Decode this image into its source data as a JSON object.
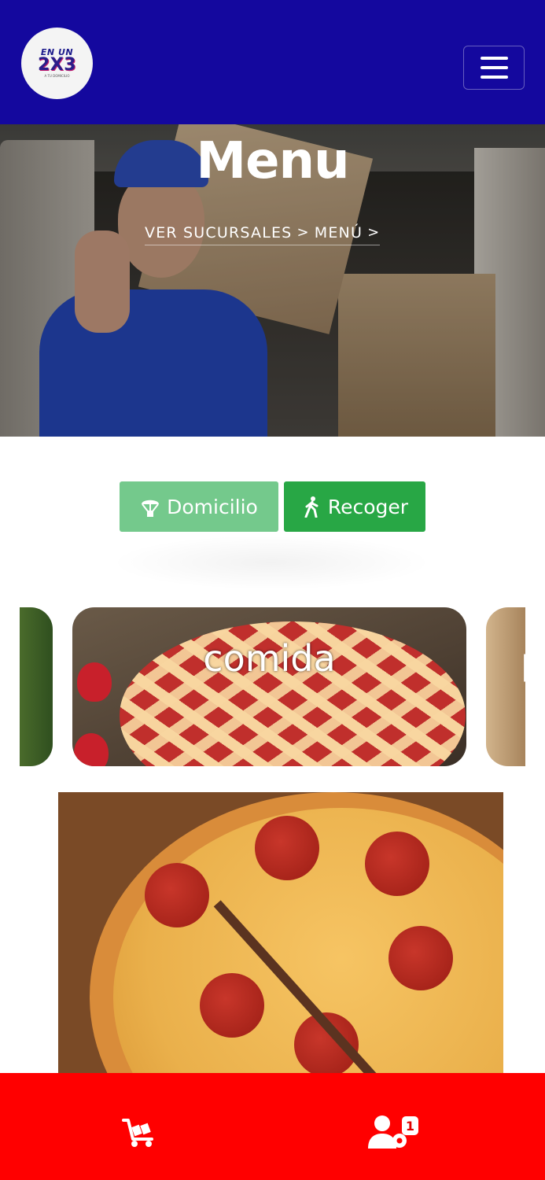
{
  "header": {
    "logo": {
      "line1": "EN UN",
      "line2": "2X3",
      "line3": "A TU DOMICILIO"
    },
    "menu_icon": "hamburger-menu-icon"
  },
  "hero": {
    "title": "Menu",
    "breadcrumb": [
      "VER SUCURSALES",
      "MENÚ"
    ],
    "breadcrumb_separator": ">"
  },
  "order_mode": {
    "domicilio_label": "Domicilio",
    "domicilio_icon": "parachute-box-icon",
    "recoger_label": "Recoger",
    "recoger_icon": "walking-person-icon"
  },
  "categories": {
    "active_label": "comida",
    "next_label_partial": "p"
  },
  "bottom_nav": {
    "cart_icon": "cart-flatbed-icon",
    "user_icon": "user-gear-icon",
    "user_badge": "1"
  },
  "colors": {
    "header_bg": "#14089e",
    "bottom_bar_bg": "#ff0000",
    "domicilio_bg": "#74c98c",
    "recoger_bg": "#28a745"
  }
}
